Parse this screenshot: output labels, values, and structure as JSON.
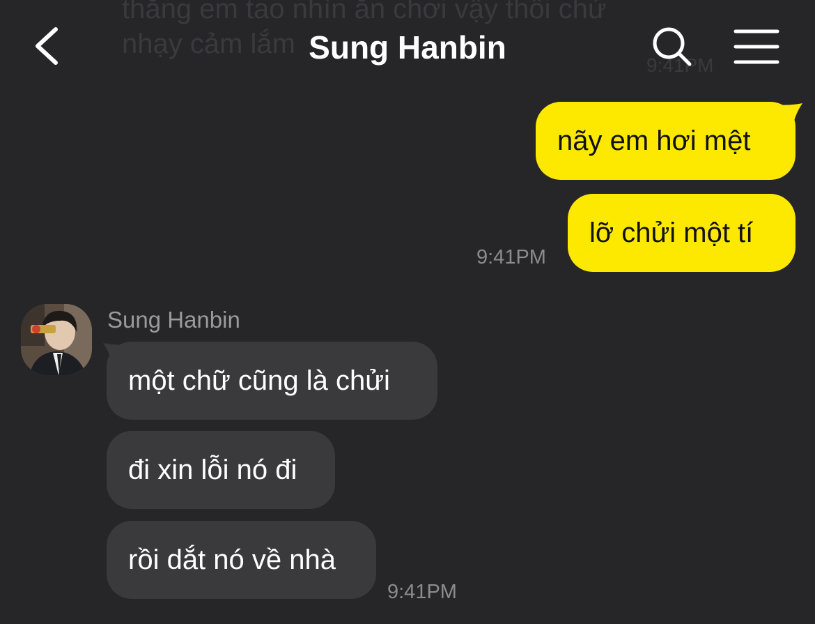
{
  "header": {
    "title": "Sung Hanbin",
    "back_icon": "chevron-left-icon",
    "search_icon": "search-icon",
    "menu_icon": "hamburger-menu-icon"
  },
  "ghost_message": {
    "text": "thằng em tao nhìn ăn chơi vậy thôi chứ nhạy cảm lắm",
    "time": "9:41PM"
  },
  "outgoing_group": {
    "messages": [
      "nãy em hơi mệt",
      "lỡ chửi một tí"
    ],
    "time": "9:41PM"
  },
  "incoming_group": {
    "sender_name": "Sung Hanbin",
    "messages": [
      "một chữ cũng là chửi",
      "đi xin lỗi nó đi",
      "rồi dắt nó về nhà"
    ],
    "time": "9:41PM"
  },
  "colors": {
    "background": "#262629",
    "outgoing_bubble": "#fde800",
    "incoming_bubble": "#3a3a3d",
    "timestamp": "#8c8c8f"
  }
}
